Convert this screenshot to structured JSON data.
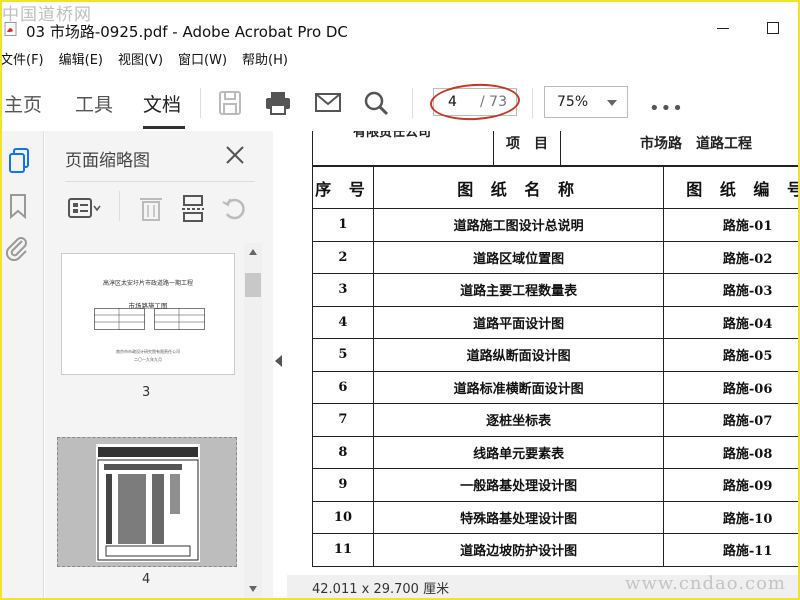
{
  "watermark": {
    "top": "中国道桥网",
    "bottom": "www.cndao.com"
  },
  "window": {
    "title": "03 市场路-0925.pdf - Adobe Acrobat Pro DC"
  },
  "menu": [
    "文件(F)",
    "编辑(E)",
    "视图(V)",
    "窗口(W)",
    "帮助(H)"
  ],
  "tabs": {
    "home": "主页",
    "tools": "工具",
    "document": "文档"
  },
  "page_nav": {
    "current": "4",
    "total": "/ 73"
  },
  "zoom": {
    "value": "75%"
  },
  "panel": {
    "title": "页面缩略图",
    "thumb1": {
      "heading": "高淳区太安圩片市政道路一期工程",
      "subheading": "市场路施工图",
      "footer1": "南京市市政设计研究院有限责任公司",
      "footer2": "二〇一九年九月"
    },
    "page_labels": [
      "3",
      "4"
    ]
  },
  "document": {
    "header_org": "有限责任公司",
    "header_item_label": "项　目",
    "header_item_value": "市场路　道路工程",
    "columns": [
      "序 号",
      "图 纸 名 称",
      "图 纸 编 号"
    ],
    "rows": [
      {
        "no": "1",
        "name": "道路施工图设计总说明",
        "code": "路施-01"
      },
      {
        "no": "2",
        "name": "道路区域位置图",
        "code": "路施-02"
      },
      {
        "no": "3",
        "name": "道路主要工程数量表",
        "code": "路施-03"
      },
      {
        "no": "4",
        "name": "道路平面设计图",
        "code": "路施-04"
      },
      {
        "no": "5",
        "name": "道路纵断面设计图",
        "code": "路施-05"
      },
      {
        "no": "6",
        "name": "道路标准横断面设计图",
        "code": "路施-06"
      },
      {
        "no": "7",
        "name": "逐桩坐标表",
        "code": "路施-07"
      },
      {
        "no": "8",
        "name": "线路单元要素表",
        "code": "路施-08"
      },
      {
        "no": "9",
        "name": "一般路基处理设计图",
        "code": "路施-09"
      },
      {
        "no": "10",
        "name": "特殊路基处理设计图",
        "code": "路施-10"
      },
      {
        "no": "11",
        "name": "道路边坡防护设计图",
        "code": "路施-11"
      }
    ]
  },
  "status": {
    "dimensions": "42.011 x 29.700 厘米"
  },
  "colors": {
    "annotation_oval": "#c0392b",
    "frame": "#f2e32a"
  }
}
